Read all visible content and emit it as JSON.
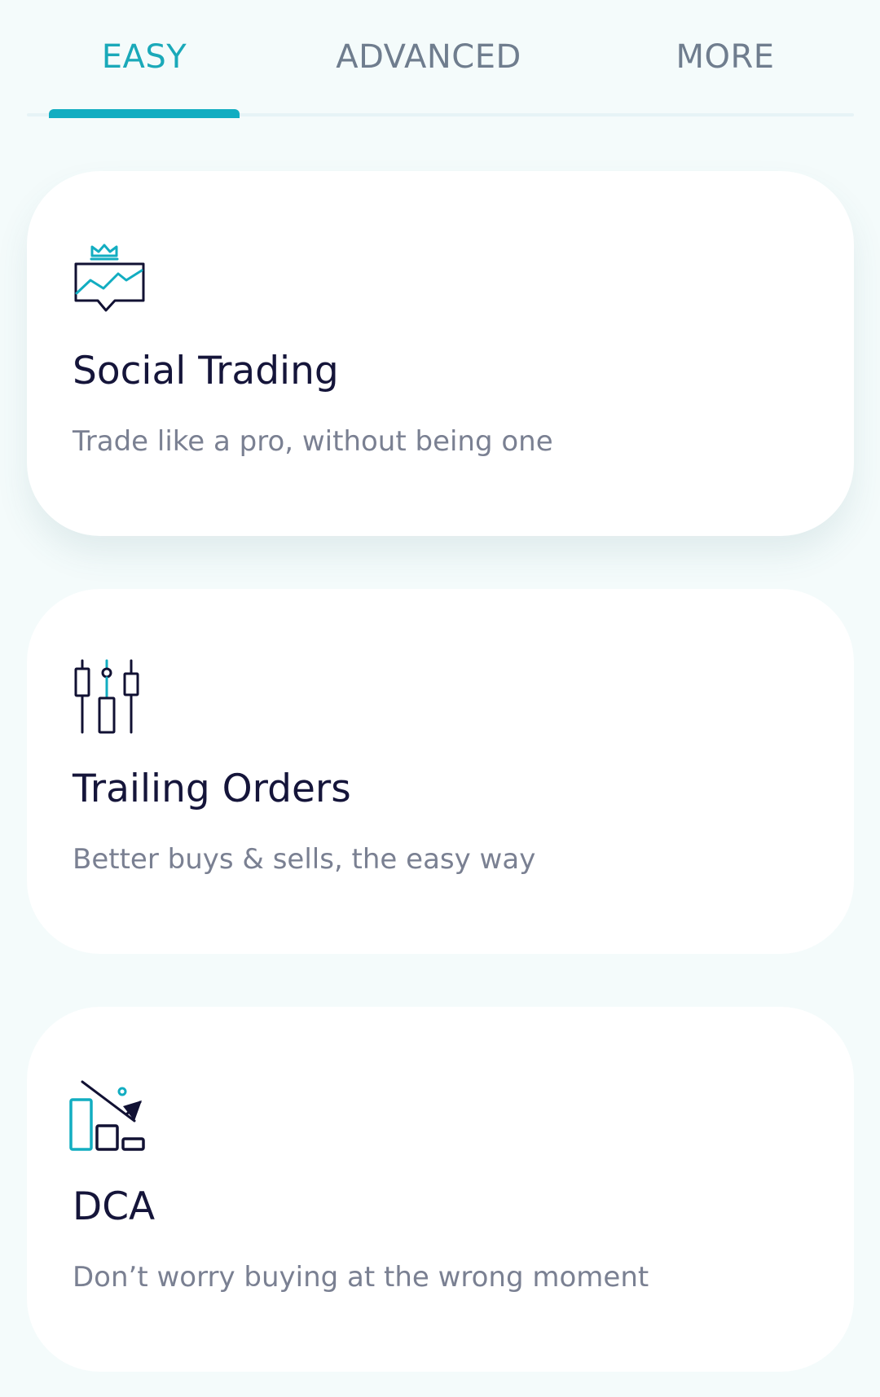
{
  "tabs": {
    "easy": "EASY",
    "advanced": "ADVANCED",
    "more": "MORE",
    "active": "EASY"
  },
  "colors": {
    "accent": "#12adc1",
    "title": "#15153a",
    "subtitle": "#7a8092",
    "background": "#f4fbfb"
  },
  "cards": [
    {
      "icon": "social-trading-icon",
      "title": "Social Trading",
      "description": "Trade like a pro, without being one"
    },
    {
      "icon": "trailing-orders-icon",
      "title": "Trailing Orders",
      "description": "Better buys & sells, the easy way"
    },
    {
      "icon": "dca-icon",
      "title": "DCA",
      "description": "Don’t worry buying at the wrong moment"
    }
  ]
}
